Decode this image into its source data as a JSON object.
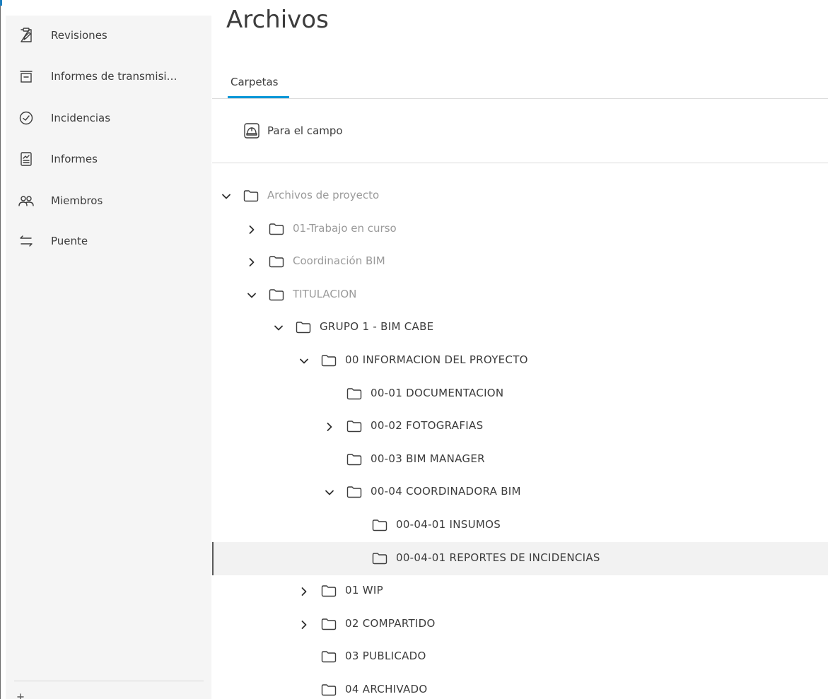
{
  "page": {
    "title": "Archivos"
  },
  "sidebar": {
    "items": [
      {
        "label": "Revisiones",
        "icon": "revisions-clipboard-icon"
      },
      {
        "label": "Informes de transmisi…",
        "icon": "tray-icon"
      },
      {
        "label": "Incidencias",
        "icon": "check-circle-icon"
      },
      {
        "label": "Informes",
        "icon": "report-icon"
      },
      {
        "label": "Miembros",
        "icon": "members-icon"
      },
      {
        "label": "Puente",
        "icon": "swap-arrows-icon"
      }
    ]
  },
  "tabs": {
    "folders_label": "Carpetas",
    "active_color": "#0696d7"
  },
  "field": {
    "label": "Para el campo",
    "icon": "hardhat-icon"
  },
  "tree": {
    "rows": [
      {
        "label": "Archivos de proyecto",
        "expand": "expanded",
        "style": "muted"
      },
      {
        "label": "01-Trabajo en curso",
        "expand": "collapsed",
        "style": "muted"
      },
      {
        "label": "Coordinación BIM",
        "expand": "collapsed",
        "style": "muted"
      },
      {
        "label": "TITULACION",
        "expand": "expanded",
        "style": "muted"
      },
      {
        "label": "GRUPO 1 - BIM CABE",
        "expand": "expanded",
        "style": "dark"
      },
      {
        "label": "00 INFORMACION DEL PROYECTO",
        "expand": "expanded",
        "style": "dark"
      },
      {
        "label": "00-01 DOCUMENTACION",
        "expand": "none",
        "style": "dark"
      },
      {
        "label": "00-02 FOTOGRAFIAS",
        "expand": "collapsed",
        "style": "dark"
      },
      {
        "label": "00-03 BIM MANAGER",
        "expand": "none",
        "style": "dark"
      },
      {
        "label": "00-04 COORDINADORA BIM",
        "expand": "expanded",
        "style": "dark"
      },
      {
        "label": "00-04-01 INSUMOS",
        "expand": "none",
        "style": "dark"
      },
      {
        "label": "00-04-01 REPORTES DE INCIDENCIAS",
        "expand": "none",
        "style": "dark",
        "selected": true
      },
      {
        "label": "01 WIP",
        "expand": "collapsed",
        "style": "dark"
      },
      {
        "label": "02 COMPARTIDO",
        "expand": "collapsed",
        "style": "dark"
      },
      {
        "label": "03 PUBLICADO",
        "expand": "none",
        "style": "dark"
      },
      {
        "label": "04 ARCHIVADO",
        "expand": "none",
        "style": "dark"
      }
    ]
  }
}
